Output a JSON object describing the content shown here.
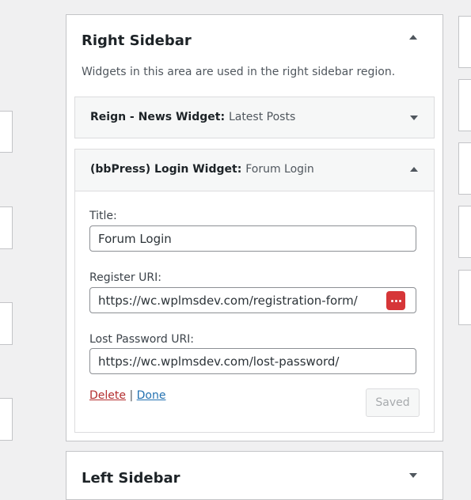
{
  "right_sidebar": {
    "title": "Right Sidebar",
    "description": "Widgets in this area are used in the right sidebar region.",
    "collapse_icon": "arrow-up-icon"
  },
  "news_widget": {
    "name": "Reign - News Widget",
    "separator": ": ",
    "subtitle": "Latest Posts",
    "toggle_icon": "arrow-down-icon"
  },
  "login_widget": {
    "name": "(bbPress) Login Widget",
    "separator": ": ",
    "subtitle": "Forum Login",
    "toggle_icon": "arrow-up-icon",
    "fields": {
      "title_label": "Title:",
      "title_value": "Forum Login",
      "register_label": "Register URI:",
      "register_value": "https://wc.wplmsdev.com/registration-form/",
      "lost_label": "Lost Password URI:",
      "lost_value": "https://wc.wplmsdev.com/lost-password/"
    },
    "password_manager_icon": "password-manager-icon",
    "delete_label": "Delete",
    "link_separator": "|",
    "done_label": "Done",
    "saved_label": "Saved"
  },
  "left_sidebar": {
    "title": "Left Sidebar",
    "toggle_icon": "arrow-down-icon"
  },
  "colors": {
    "background": "#f0f0f1",
    "delete": "#b32d2e",
    "done": "#2271b1",
    "password_badge": "#d63638"
  }
}
